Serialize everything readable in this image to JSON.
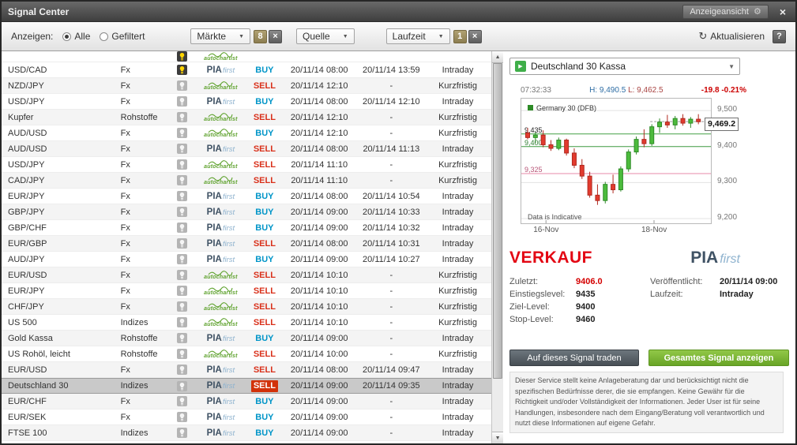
{
  "window": {
    "title": "Signal Center",
    "view_button": "Anzeigeansicht"
  },
  "icons": {
    "gear": "⚙",
    "close": "×",
    "chevron_down": "▼",
    "up_arrow": "▲",
    "down_arrow": "▼",
    "refresh": "↻",
    "help": "?",
    "play": "▶",
    "clear": "×"
  },
  "toolbar": {
    "show_label": "Anzeigen:",
    "radio_all": "Alle",
    "radio_filtered": "Gefiltert",
    "markets_label": "Märkte",
    "markets_count": "8",
    "source_label": "Quelle",
    "period_label": "Laufzeit",
    "period_count": "1",
    "refresh_label": "Aktualisieren"
  },
  "table": {
    "rows": [
      {
        "partial": true,
        "market": "",
        "category": "",
        "bulb": "active",
        "source": "autochartist",
        "action": "",
        "time1": "",
        "time2": "",
        "term": ""
      },
      {
        "market": "USD/CAD",
        "category": "Fx",
        "bulb": "active",
        "source": "piafirst",
        "action": "BUY",
        "time1": "20/11/14 08:00",
        "time2": "20/11/14 13:59",
        "term": "Intraday"
      },
      {
        "market": "NZD/JPY",
        "category": "Fx",
        "bulb": "normal",
        "source": "autochartist",
        "action": "SELL",
        "time1": "20/11/14 12:10",
        "time2": "-",
        "term": "Kurzfristig"
      },
      {
        "market": "USD/JPY",
        "category": "Fx",
        "bulb": "normal",
        "source": "piafirst",
        "action": "BUY",
        "time1": "20/11/14 08:00",
        "time2": "20/11/14 12:10",
        "term": "Intraday"
      },
      {
        "market": "Kupfer",
        "category": "Rohstoffe",
        "bulb": "normal",
        "source": "autochartist",
        "action": "SELL",
        "time1": "20/11/14 12:10",
        "time2": "-",
        "term": "Kurzfristig"
      },
      {
        "market": "AUD/USD",
        "category": "Fx",
        "bulb": "normal",
        "source": "autochartist",
        "action": "BUY",
        "time1": "20/11/14 12:10",
        "time2": "-",
        "term": "Kurzfristig"
      },
      {
        "market": "AUD/USD",
        "category": "Fx",
        "bulb": "normal",
        "source": "piafirst",
        "action": "SELL",
        "time1": "20/11/14 08:00",
        "time2": "20/11/14 11:13",
        "term": "Intraday"
      },
      {
        "market": "USD/JPY",
        "category": "Fx",
        "bulb": "normal",
        "source": "autochartist",
        "action": "SELL",
        "time1": "20/11/14 11:10",
        "time2": "-",
        "term": "Kurzfristig"
      },
      {
        "market": "CAD/JPY",
        "category": "Fx",
        "bulb": "normal",
        "source": "autochartist",
        "action": "SELL",
        "time1": "20/11/14 11:10",
        "time2": "-",
        "term": "Kurzfristig"
      },
      {
        "market": "EUR/JPY",
        "category": "Fx",
        "bulb": "normal",
        "source": "piafirst",
        "action": "BUY",
        "time1": "20/11/14 08:00",
        "time2": "20/11/14 10:54",
        "term": "Intraday"
      },
      {
        "market": "GBP/JPY",
        "category": "Fx",
        "bulb": "normal",
        "source": "piafirst",
        "action": "BUY",
        "time1": "20/11/14 09:00",
        "time2": "20/11/14 10:33",
        "term": "Intraday"
      },
      {
        "market": "GBP/CHF",
        "category": "Fx",
        "bulb": "normal",
        "source": "piafirst",
        "action": "BUY",
        "time1": "20/11/14 09:00",
        "time2": "20/11/14 10:32",
        "term": "Intraday"
      },
      {
        "market": "EUR/GBP",
        "category": "Fx",
        "bulb": "normal",
        "source": "piafirst",
        "action": "SELL",
        "time1": "20/11/14 08:00",
        "time2": "20/11/14 10:31",
        "term": "Intraday"
      },
      {
        "market": "AUD/JPY",
        "category": "Fx",
        "bulb": "normal",
        "source": "piafirst",
        "action": "BUY",
        "time1": "20/11/14 09:00",
        "time2": "20/11/14 10:27",
        "term": "Intraday"
      },
      {
        "market": "EUR/USD",
        "category": "Fx",
        "bulb": "normal",
        "source": "autochartist",
        "action": "SELL",
        "time1": "20/11/14 10:10",
        "time2": "-",
        "term": "Kurzfristig"
      },
      {
        "market": "EUR/JPY",
        "category": "Fx",
        "bulb": "normal",
        "source": "autochartist",
        "action": "SELL",
        "time1": "20/11/14 10:10",
        "time2": "-",
        "term": "Kurzfristig"
      },
      {
        "market": "CHF/JPY",
        "category": "Fx",
        "bulb": "normal",
        "source": "autochartist",
        "action": "SELL",
        "time1": "20/11/14 10:10",
        "time2": "-",
        "term": "Kurzfristig"
      },
      {
        "market": "US 500",
        "category": "Indizes",
        "bulb": "normal",
        "source": "autochartist",
        "action": "SELL",
        "time1": "20/11/14 10:10",
        "time2": "-",
        "term": "Kurzfristig"
      },
      {
        "market": "Gold Kassa",
        "category": "Rohstoffe",
        "bulb": "normal",
        "source": "piafirst",
        "action": "BUY",
        "time1": "20/11/14 09:00",
        "time2": "-",
        "term": "Intraday"
      },
      {
        "market": "US Rohöl, leicht",
        "category": "Rohstoffe",
        "bulb": "normal",
        "source": "autochartist",
        "action": "SELL",
        "time1": "20/11/14 10:00",
        "time2": "-",
        "term": "Kurzfristig"
      },
      {
        "market": "EUR/USD",
        "category": "Fx",
        "bulb": "normal",
        "source": "piafirst",
        "action": "SELL",
        "time1": "20/11/14 08:00",
        "time2": "20/11/14 09:47",
        "term": "Intraday"
      },
      {
        "market": "Deutschland 30",
        "category": "Indizes",
        "bulb": "normal",
        "source": "piafirst",
        "action": "SELL",
        "time1": "20/11/14 09:00",
        "time2": "20/11/14 09:35",
        "term": "Intraday",
        "selected": true
      },
      {
        "market": "EUR/CHF",
        "category": "Fx",
        "bulb": "normal",
        "source": "piafirst",
        "action": "BUY",
        "time1": "20/11/14 09:00",
        "time2": "-",
        "term": "Intraday"
      },
      {
        "market": "EUR/SEK",
        "category": "Fx",
        "bulb": "normal",
        "source": "piafirst",
        "action": "BUY",
        "time1": "20/11/14 09:00",
        "time2": "-",
        "term": "Intraday"
      },
      {
        "market": "FTSE 100",
        "category": "Indizes",
        "bulb": "normal",
        "source": "piafirst",
        "action": "BUY",
        "time1": "20/11/14 09:00",
        "time2": "-",
        "term": "Intraday"
      }
    ]
  },
  "detail": {
    "instrument": "Deutschland 30 Kassa",
    "chart_header": {
      "time": "07:32:33",
      "high": "H: 9,490.5",
      "low": "L: 9,462.5",
      "change": "-19.8",
      "change_pct": "-0.21%"
    },
    "signal": {
      "direction": "VERKAUF",
      "source_bold": "PIA",
      "source_italic": "first",
      "last_label": "Zuletzt:",
      "last_value": "9406.0",
      "entry_label": "Einstiegslevel:",
      "entry_value": "9435",
      "target_label": "Ziel-Level:",
      "target_value": "9400",
      "stop_label": "Stop-Level:",
      "stop_value": "9460",
      "published_label": "Veröffentlicht:",
      "published_value": "20/11/14 09:00",
      "term_label": "Laufzeit:",
      "term_value": "Intraday"
    },
    "trade_button": "Auf dieses Signal traden",
    "view_signal_button": "Gesamtes Signal anzeigen",
    "disclaimer": "Dieser Service stellt keine Anlageberatung dar und berücksichtigt nicht die spezifischen Bedürfnisse derer, die sie empfangen. Keine Gewähr für die Richtigkeit und/oder Vollständigkeit der Informationen. Jeder User ist für seine Handlungen, insbesondere nach dem Eingang/Beratung voll verantwortlich und nutzt diese Informationen auf eigene Gefahr."
  },
  "chart_data": {
    "type": "candlestick",
    "title": "Germany 30 (DFB)",
    "note": "Data is Indicative",
    "ylim": [
      9200,
      9520
    ],
    "y_ticks": [
      9500,
      9400,
      9300,
      9200
    ],
    "y_tick_labels": [
      "9,500",
      "9,400",
      "9,300",
      "9,200"
    ],
    "x_ticks": [
      "16-Nov",
      "18-Nov"
    ],
    "x_tick_pos": [
      0.13,
      0.7
    ],
    "levels": [
      {
        "value": 9435,
        "label": "9,435",
        "color": "#43a047",
        "label_color": "#222222"
      },
      {
        "value": 9400,
        "label": "9,400",
        "color": "#43a047",
        "label_color": "#2e7d32"
      },
      {
        "value": 9325,
        "label": "9,325",
        "color": "#e78aa8",
        "label_color": "#b85577"
      }
    ],
    "last_price": 9469.2,
    "last_price_label": "9,469.2",
    "candles": [
      [
        9438,
        9452,
        9420,
        9425
      ],
      [
        9425,
        9440,
        9410,
        9432
      ],
      [
        9432,
        9445,
        9398,
        9405
      ],
      [
        9405,
        9418,
        9388,
        9395
      ],
      [
        9395,
        9425,
        9390,
        9418
      ],
      [
        9418,
        9422,
        9375,
        9382
      ],
      [
        9382,
        9395,
        9340,
        9348
      ],
      [
        9348,
        9365,
        9310,
        9318
      ],
      [
        9318,
        9330,
        9258,
        9265
      ],
      [
        9265,
        9295,
        9238,
        9250
      ],
      [
        9250,
        9302,
        9242,
        9295
      ],
      [
        9295,
        9322,
        9270,
        9280
      ],
      [
        9280,
        9345,
        9275,
        9338
      ],
      [
        9338,
        9392,
        9330,
        9385
      ],
      [
        9385,
        9428,
        9378,
        9420
      ],
      [
        9420,
        9448,
        9398,
        9408
      ],
      [
        9408,
        9462,
        9402,
        9455
      ],
      [
        9455,
        9478,
        9438,
        9468
      ],
      [
        9468,
        9488,
        9452,
        9460
      ],
      [
        9460,
        9485,
        9448,
        9478
      ],
      [
        9478,
        9490,
        9458,
        9465
      ],
      [
        9465,
        9482,
        9452,
        9476
      ],
      [
        9476,
        9490,
        9462,
        9469
      ]
    ]
  }
}
